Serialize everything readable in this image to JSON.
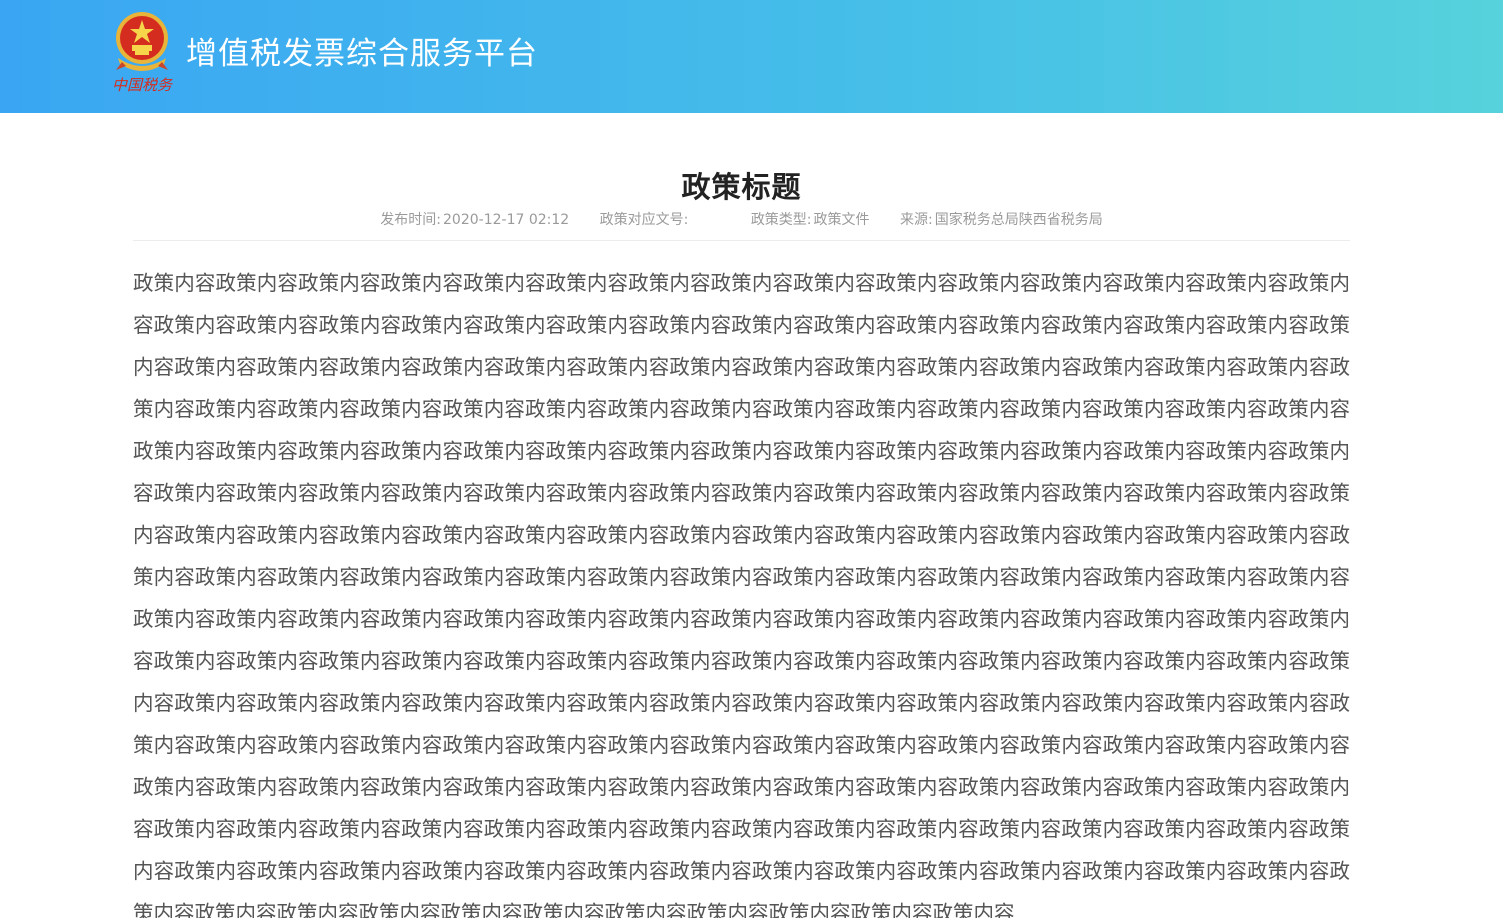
{
  "header": {
    "site_title": "增值税发票综合服务平台",
    "logo_icon": "china-tax-emblem-icon",
    "logo_caption": "中国税务",
    "colors": {
      "gradient_start": "#3aa6f3",
      "gradient_end": "#56d2dc"
    }
  },
  "article": {
    "title": "政策标题",
    "meta": {
      "publish_time_label": "发布时间:",
      "publish_time_value": "2020-12-17 02:12",
      "doc_number_label": "政策对应文号:",
      "doc_number_value": "",
      "policy_type_label": "政策类型:",
      "policy_type_value": "政策文件",
      "source_label": "来源:",
      "source_value": "国家税务总局陕西省税务局"
    },
    "body": "政策内容政策内容政策内容政策内容政策内容政策内容政策内容政策内容政策内容政策内容政策内容政策内容政策内容政策内容政策内容政策内容政策内容政策内容政策内容政策内容政策内容政策内容政策内容政策内容政策内容政策内容政策内容政策内容政策内容政策内容政策内容政策内容政策内容政策内容政策内容政策内容政策内容政策内容政策内容政策内容政策内容政策内容政策内容政策内容政策内容政策内容政策内容政策内容政策内容政策内容政策内容政策内容政策内容政策内容政策内容政策内容政策内容政策内容政策内容政策内容政策内容政策内容政策内容政策内容政策内容政策内容政策内容政策内容政策内容政策内容政策内容政策内容政策内容政策内容政策内容政策内容政策内容政策内容政策内容政策内容政策内容政策内容政策内容政策内容政策内容政策内容政策内容政策内容政策内容政策内容政策内容政策内容政策内容政策内容政策内容政策内容政策内容政策内容政策内容政策内容政策内容政策内容政策内容政策内容政策内容政策内容政策内容政策内容政策内容政策内容政策内容政策内容政策内容政策内容政策内容政策内容政策内容政策内容政策内容政策内容政策内容政策内容政策内容政策内容政策内容政策内容政策内容政策内容政策内容政策内容政策内容政策内容政策内容政策内容政策内容政策内容政策内容政策内容政策内容政策内容政策内容政策内容政策内容政策内容政策内容政策内容政策内容政策内容政策内容政策内容政策内容政策内容政策内容政策内容政策内容政策内容政策内容政策内容政策内容政策内容政策内容政策内容政策内容政策内容政策内容政策内容政策内容政策内容政策内容政策内容政策内容政策内容政策内容政策内容政策内容政策内容政策内容政策内容政策内容政策内容政策内容政策内容政策内容政策内容政策内容政策内容政策内容政策内容政策内容政策内容政策内容政策内容政策内容政策内容政策内容政策内容政策内容政策内容政策内容政策内容政策内容政策内容政策内容政策内容政策内容政策内容政策内容政策内容政策内容政策内容政策内容政策内容政策内容政策内容政策内容政策内容政策内容政策内容政策内容政策内容政策内容政策内容政策内容政策内容政策内容政策内容政策内容政策内容政策内容政策内容政策内容政策内容"
  }
}
